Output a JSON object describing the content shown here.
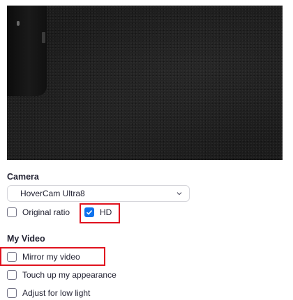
{
  "camera": {
    "heading": "Camera",
    "selected_device": "HoverCam Ultra8",
    "original_ratio_label": "Original ratio",
    "original_ratio_checked": false,
    "hd_label": "HD",
    "hd_checked": true
  },
  "my_video": {
    "heading": "My Video",
    "mirror_label": "Mirror my video",
    "mirror_checked": false,
    "touch_up_label": "Touch up my appearance",
    "touch_up_checked": false,
    "low_light_label": "Adjust for low light",
    "low_light_checked": false
  },
  "colors": {
    "accent": "#0e72ed",
    "highlight": "#e0121e"
  },
  "icons": {
    "dropdown": "chevron-down-icon",
    "check": "checkmark-icon"
  }
}
